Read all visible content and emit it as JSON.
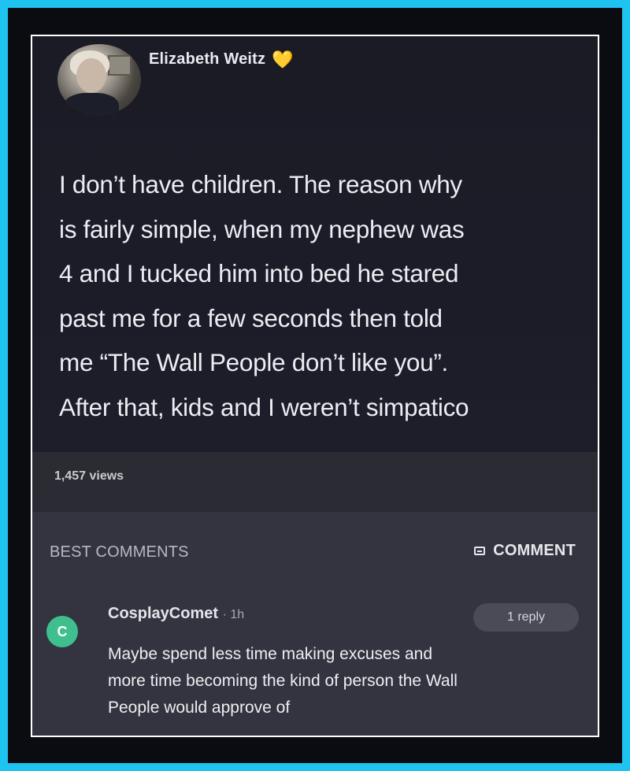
{
  "post": {
    "author": "Elizabeth Weitz",
    "author_badge_icon": "yellow-heart-icon",
    "lines": [
      "I don’t have children. The reason why",
      "is fairly simple, when my nephew was",
      "4 and I tucked him into bed he stared",
      "past me for a few seconds then told",
      "me “The Wall People don’t like you”.",
      "After that, kids and I weren’t simpatico"
    ],
    "views": "1,457 views"
  },
  "comments": {
    "header": "BEST COMMENTS",
    "comment_button": "COMMENT",
    "items": [
      {
        "avatar_letter": "C",
        "avatar_color": "#3fbf8e",
        "username": "CosplayComet",
        "time": "· 1h",
        "reply_count": "1 reply",
        "lines": [
          "Maybe spend less time making excuses and",
          "more time becoming the kind of person the Wall",
          "People would approve of"
        ]
      }
    ]
  },
  "colors": {
    "border": "#1fc3f0",
    "heart": "#f2c74a"
  }
}
